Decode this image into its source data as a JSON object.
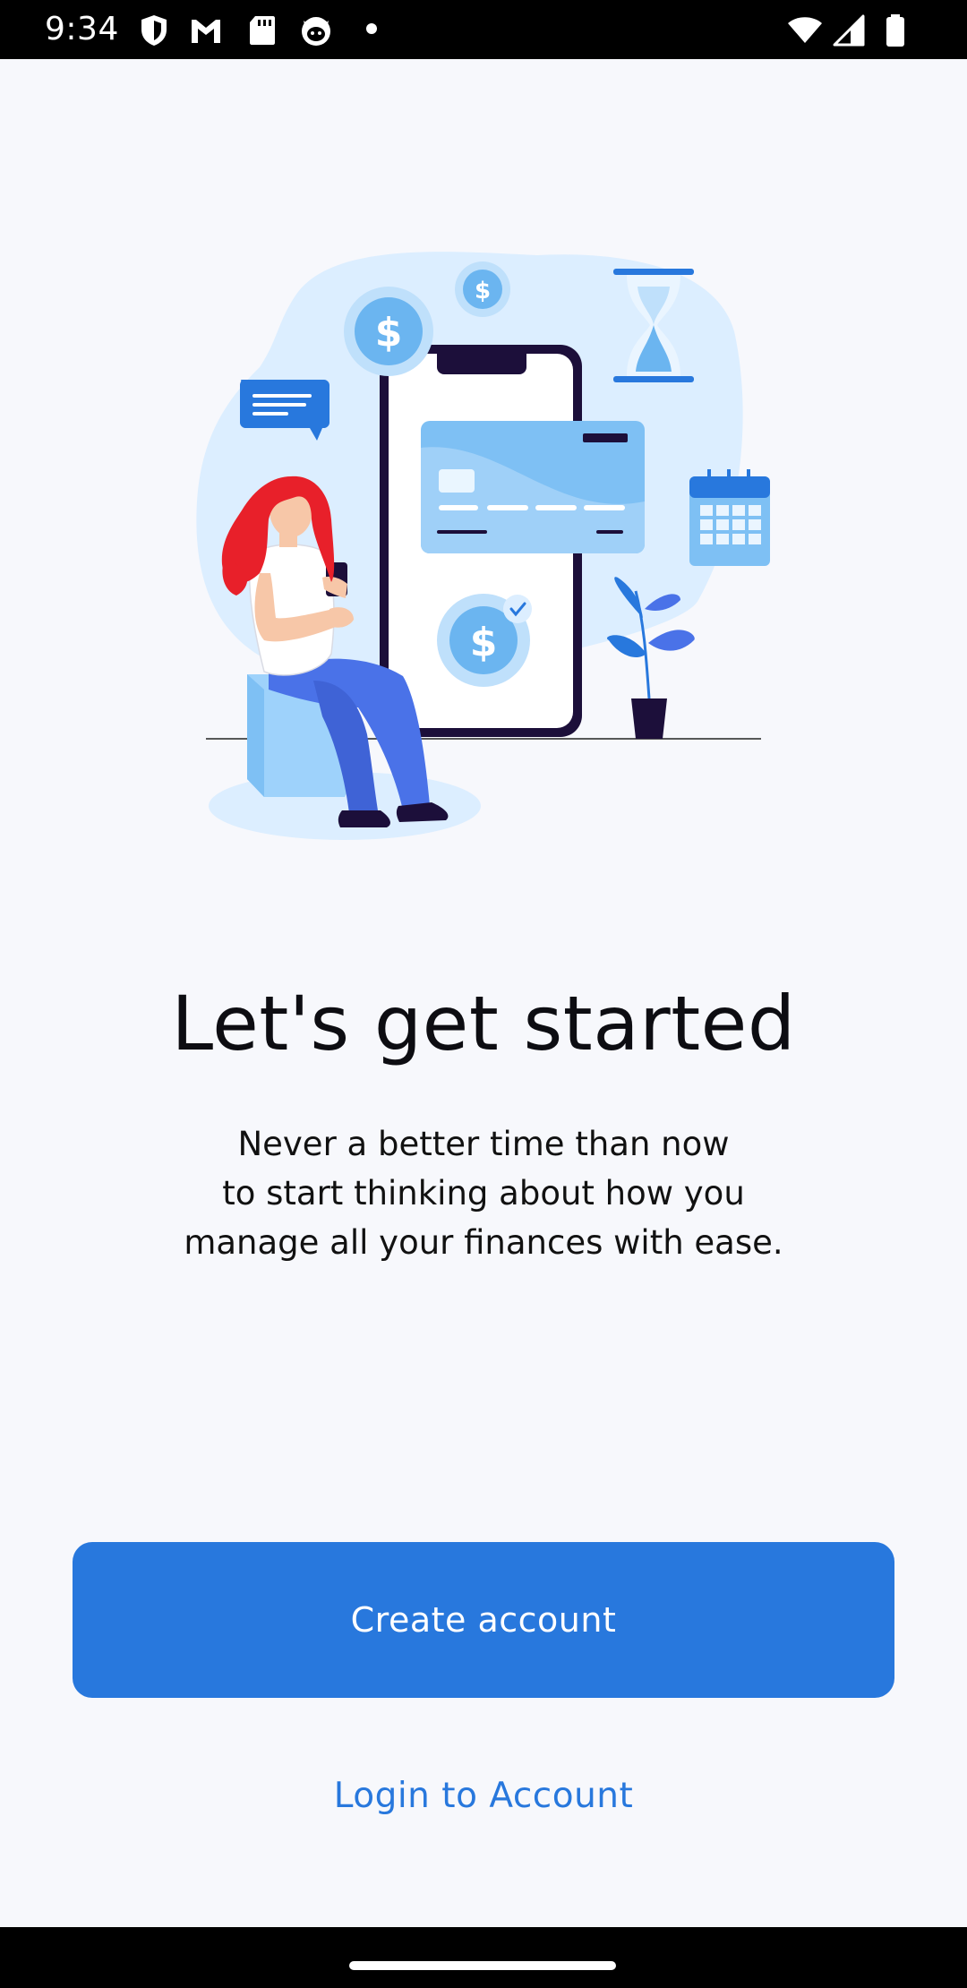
{
  "status_bar": {
    "time": "9:34",
    "icons": [
      "shield-icon",
      "gmail-icon",
      "sd-card-icon",
      "cat-icon",
      "notification-dot-icon",
      "wifi-icon",
      "signal-icon",
      "battery-icon"
    ]
  },
  "illustration": {
    "name": "woman with phone and credit card",
    "colors": {
      "accent": "#2878dd",
      "light_blue": "#dceeff",
      "card_blue": "#7ec0f4",
      "hair_red": "#e8202a",
      "jeans_blue": "#4a72e8",
      "dark": "#1c0f3a"
    }
  },
  "main": {
    "title": "Let's get started",
    "subtitle_lines": [
      "Never a better time than now",
      "to start thinking about how you",
      "manage all your finances with ease."
    ]
  },
  "actions": {
    "create_label": "Create account",
    "login_label": "Login to Account"
  },
  "theme": {
    "background": "#f7f8fc",
    "primary": "#2878dd",
    "text": "#0d0d12"
  }
}
